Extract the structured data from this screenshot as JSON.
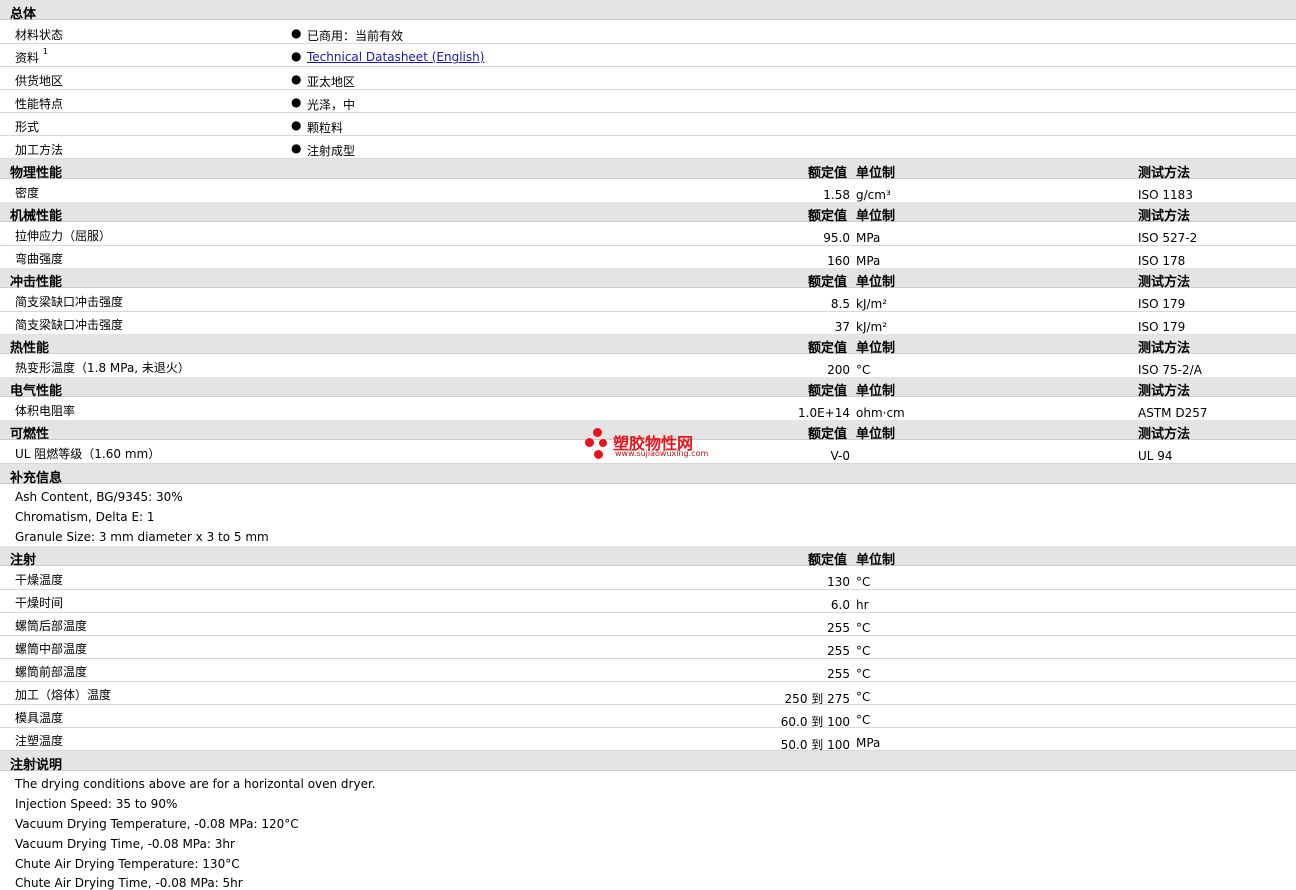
{
  "general": {
    "title": "总体",
    "rows": [
      {
        "label": "材料状态",
        "value": "已商用：当前有效"
      },
      {
        "label": "资料",
        "sup": "1",
        "value": "Technical Datasheet (English)"
      },
      {
        "label": "供货地区",
        "value": "亚太地区"
      },
      {
        "label": "性能特点",
        "value": "光泽，中"
      },
      {
        "label": "形式",
        "value": "颗粒料"
      },
      {
        "label": "加工方法",
        "value": "注射成型"
      }
    ]
  },
  "headers": {
    "value": "额定值",
    "unit": "单位制",
    "method": "测试方法"
  },
  "physical": {
    "title": "物理性能",
    "rows": [
      {
        "label": "密度",
        "value": "1.58",
        "unit": "g/cm³",
        "method": "ISO 1183"
      }
    ]
  },
  "mechanical": {
    "title": "机械性能",
    "rows": [
      {
        "label": "拉伸应力（屈服）",
        "value": "95.0",
        "unit": "MPa",
        "method": "ISO 527-2"
      },
      {
        "label": "弯曲强度",
        "value": "160",
        "unit": "MPa",
        "method": "ISO 178"
      }
    ]
  },
  "impact": {
    "title": "冲击性能",
    "rows": [
      {
        "label": "简支梁缺口冲击强度",
        "value": "8.5",
        "unit": "kJ/m²",
        "method": "ISO 179"
      },
      {
        "label": "简支梁缺口冲击强度",
        "value": "37",
        "unit": "kJ/m²",
        "method": "ISO 179"
      }
    ]
  },
  "thermal": {
    "title": "热性能",
    "rows": [
      {
        "label": "热变形温度（1.8 MPa, 未退火）",
        "value": "200",
        "unit": "°C",
        "method": "ISO 75-2/A"
      }
    ]
  },
  "electrical": {
    "title": "电气性能",
    "rows": [
      {
        "label": "体积电阻率",
        "value": "1.0E+14",
        "unit": "ohm·cm",
        "method": "ASTM D257"
      }
    ]
  },
  "flammability": {
    "title": "可燃性",
    "rows": [
      {
        "label": "UL 阻燃等级（1.60 mm）",
        "value": "V-0",
        "unit": "",
        "method": "UL 94"
      }
    ]
  },
  "supplement": {
    "title": "补充信息",
    "lines": [
      "Ash Content, BG/9345: 30%",
      "Chromatism, Delta E: 1",
      "Granule Size: 3 mm diameter x 3 to 5 mm"
    ]
  },
  "injection": {
    "title": "注射",
    "rows": [
      {
        "label": "干燥温度",
        "value": "130",
        "unit": "°C"
      },
      {
        "label": "干燥时间",
        "value": "6.0",
        "unit": "hr"
      },
      {
        "label": "螺筒后部温度",
        "value": "255",
        "unit": "°C"
      },
      {
        "label": "螺筒中部温度",
        "value": "255",
        "unit": "°C"
      },
      {
        "label": "螺筒前部温度",
        "value": "255",
        "unit": "°C"
      },
      {
        "label": "加工（熔体）温度",
        "value": "250 到  275",
        "unit": "°C"
      },
      {
        "label": "模具温度",
        "value": "60.0 到  100",
        "unit": "°C"
      },
      {
        "label": "注塑温度",
        "value": "50.0 到  100",
        "unit": "MPa"
      }
    ]
  },
  "injection_notes": {
    "title": "注射说明",
    "lines": [
      "The drying conditions above are for a horizontal oven dryer.",
      "Injection Speed: 35 to 90%",
      "Vacuum Drying Temperature, -0.08 MPa: 120°C",
      "Vacuum Drying Time, -0.08 MPa: 3hr",
      "Chute Air Drying Temperature: 130°C",
      "Chute Air Drying Time, -0.08 MPa: 5hr"
    ]
  },
  "watermark": {
    "brand": "塑胶物性网",
    "url": "www.sujiaowuxing.com",
    "color": "#e8141d"
  }
}
